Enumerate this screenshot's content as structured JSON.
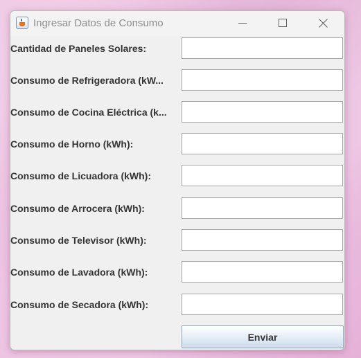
{
  "window": {
    "title": "Ingresar Datos de Consumo"
  },
  "form": {
    "fields": [
      {
        "label": "Cantidad de Paneles Solares:",
        "value": ""
      },
      {
        "label": "Consumo de Refrigeradora (kW...",
        "value": ""
      },
      {
        "label": "Consumo de Cocina Eléctrica (k...",
        "value": ""
      },
      {
        "label": "Consumo de Horno (kWh):",
        "value": ""
      },
      {
        "label": "Consumo de Licuadora (kWh):",
        "value": ""
      },
      {
        "label": "Consumo de Arrocera (kWh):",
        "value": ""
      },
      {
        "label": "Consumo de Televisor (kWh):",
        "value": ""
      },
      {
        "label": "Consumo de Lavadora (kWh):",
        "value": ""
      },
      {
        "label": "Consumo de Secadora (kWh):",
        "value": ""
      }
    ],
    "submit_label": "Enviar"
  }
}
